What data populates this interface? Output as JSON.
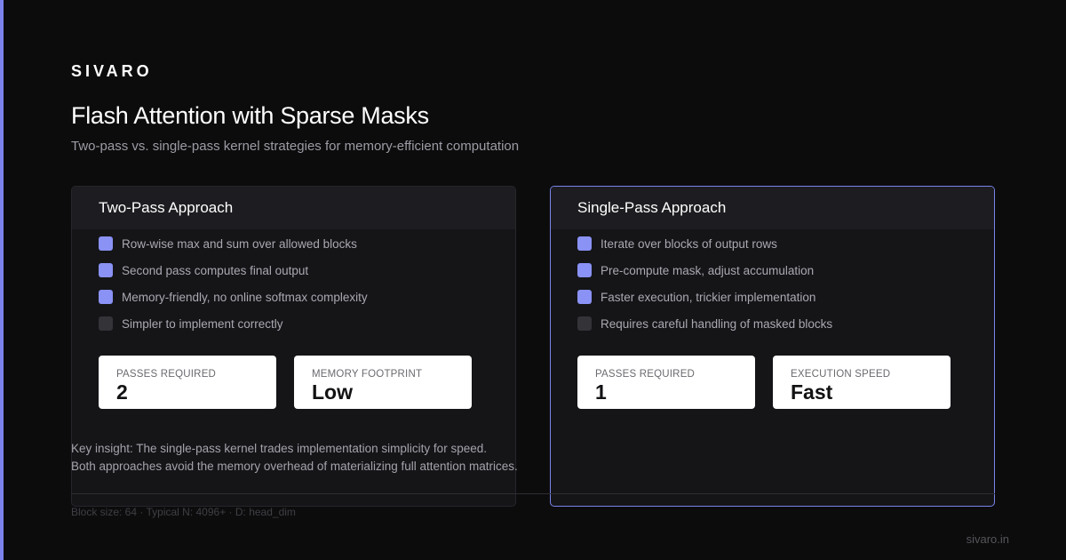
{
  "brand": "SIVARO",
  "title": "Flash Attention with Sparse Masks",
  "subtitle": "Two-pass vs. single-pass kernel strategies for memory-efficient computation",
  "colors": {
    "accent": "#7b83eb",
    "check_on": "#8a92f5",
    "check_off": "#333338",
    "background": "#0c0c0d"
  },
  "cards": [
    {
      "heading": "Two-Pass Approach",
      "items": [
        {
          "label": "Row-wise max and sum over allowed blocks",
          "checked": true
        },
        {
          "label": "Second pass computes final output",
          "checked": true
        },
        {
          "label": "Memory-friendly, no online softmax complexity",
          "checked": true
        },
        {
          "label": "Simpler to implement correctly",
          "checked": false
        }
      ],
      "stats": [
        {
          "label": "PASSES REQUIRED",
          "value": "2"
        },
        {
          "label": "MEMORY FOOTPRINT",
          "value": "Low"
        }
      ]
    },
    {
      "heading": "Single-Pass Approach",
      "highlighted": true,
      "items": [
        {
          "label": "Iterate over blocks of output rows",
          "checked": true
        },
        {
          "label": "Pre-compute mask, adjust accumulation",
          "checked": true
        },
        {
          "label": "Faster execution, trickier implementation",
          "checked": true
        },
        {
          "label": "Requires careful handling of masked blocks",
          "checked": false
        }
      ],
      "stats": [
        {
          "label": "PASSES REQUIRED",
          "value": "1"
        },
        {
          "label": "EXECUTION SPEED",
          "value": "Fast"
        }
      ]
    }
  ],
  "insight": {
    "line1": "Key insight: The single-pass kernel trades implementation simplicity for speed.",
    "line2": "Both approaches avoid the memory overhead of materializing full attention matrices."
  },
  "footnote": "Block size: 64 · Typical N: 4096+ · D: head_dim",
  "site": "sivaro.in"
}
